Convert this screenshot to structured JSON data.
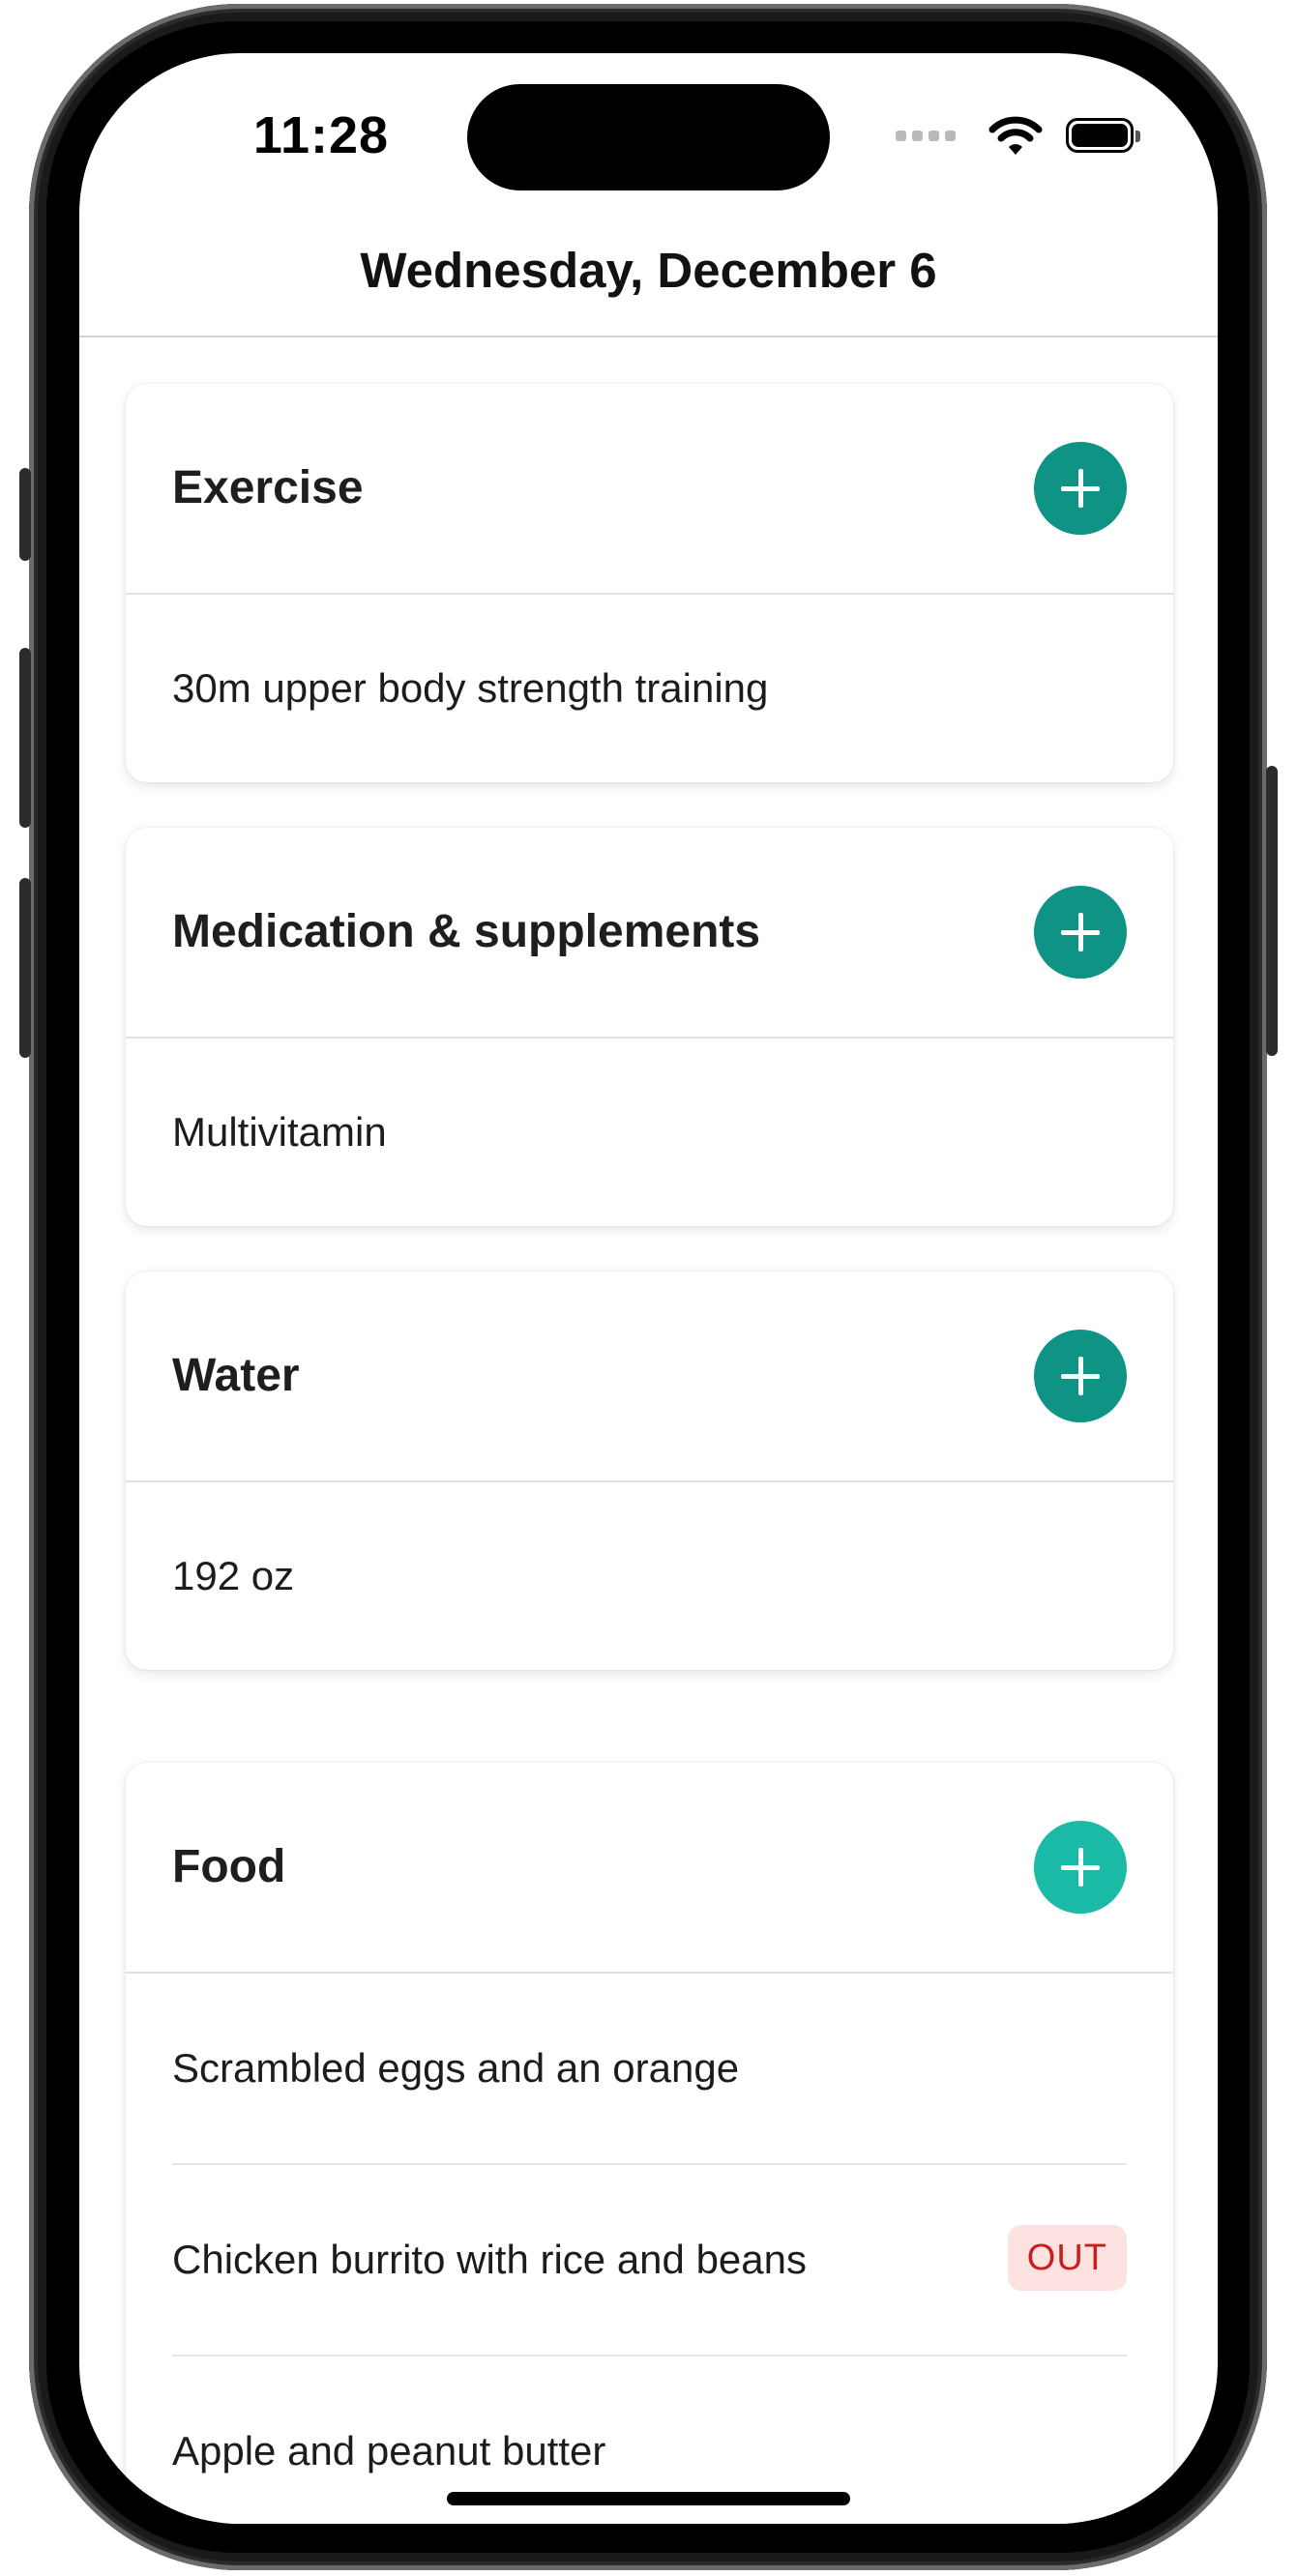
{
  "status_bar": {
    "time": "11:28"
  },
  "header": {
    "title": "Wednesday, December 6"
  },
  "colors": {
    "accent": "#0f9384",
    "accent_light": "#1bbaa6",
    "badge_bg": "#fde2e2",
    "badge_text": "#c81e1e"
  },
  "cards": [
    {
      "title": "Exercise",
      "items": [
        "30m upper body strength training"
      ]
    },
    {
      "title": "Medication & supplements",
      "items": [
        "Multivitamin"
      ]
    },
    {
      "title": "Water",
      "items": [
        "192 oz"
      ]
    }
  ],
  "food": {
    "title": "Food",
    "items": [
      {
        "label": "Scrambled eggs and an orange"
      },
      {
        "label": "Chicken burrito with rice and beans",
        "badge": "OUT"
      },
      {
        "label": "Apple and peanut butter"
      }
    ]
  },
  "icons": {
    "add": "plus-icon",
    "wifi": "wifi-icon",
    "battery": "battery-icon",
    "signal": "cellular-signal-icon"
  }
}
